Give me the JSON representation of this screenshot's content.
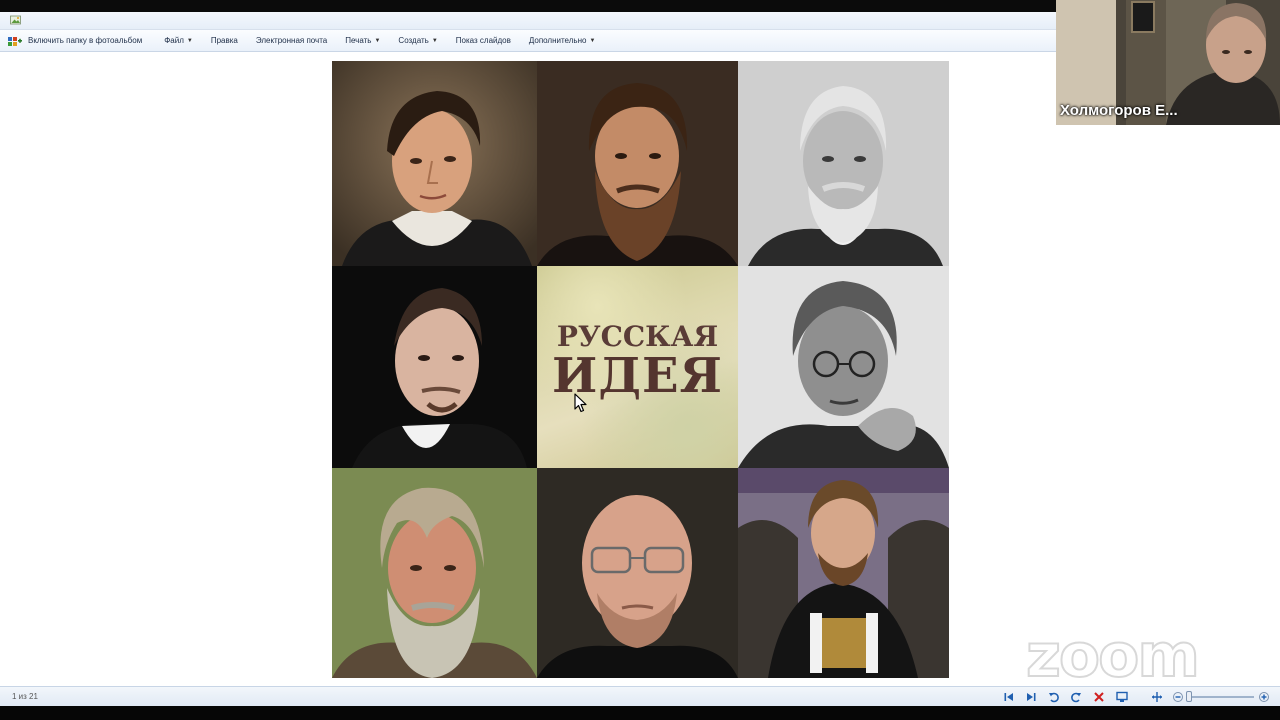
{
  "window": {
    "app_icon": "photo-viewer-icon"
  },
  "toolbar": {
    "items": [
      {
        "label": "Включить папку в фотоальбом",
        "icon": "add-folder-icon"
      },
      {
        "label": "Файл",
        "dropdown": true
      },
      {
        "label": "Правка",
        "dropdown": false
      },
      {
        "label": "Электронная почта",
        "dropdown": false
      },
      {
        "label": "Печать",
        "dropdown": true
      },
      {
        "label": "Создать",
        "dropdown": true
      },
      {
        "label": "Показ слайдов",
        "dropdown": false
      },
      {
        "label": "Дополнительно",
        "dropdown": true
      }
    ]
  },
  "image": {
    "title_line1": "РУССКАЯ",
    "title_line2": "ИДЕЯ",
    "portraits": [
      "portrait-1",
      "portrait-2",
      "portrait-3",
      "portrait-4",
      "title-tile",
      "portrait-6",
      "portrait-7",
      "portrait-8",
      "portrait-9"
    ]
  },
  "zoom": {
    "participant_name": "Холмогоров Е...",
    "watermark": "zoom"
  },
  "statusbar": {
    "position_text": "1 из 21",
    "controls": [
      "first-icon",
      "last-icon",
      "rotate-left-icon",
      "rotate-right-icon",
      "delete-icon",
      "slideshow-icon",
      "fit-icon",
      "zoom-out-icon",
      "zoom-in-icon"
    ]
  },
  "colors": {
    "toolbar_text": "#1e2e48",
    "control_blue": "#1f5fb0",
    "title_text": "#54352f"
  }
}
